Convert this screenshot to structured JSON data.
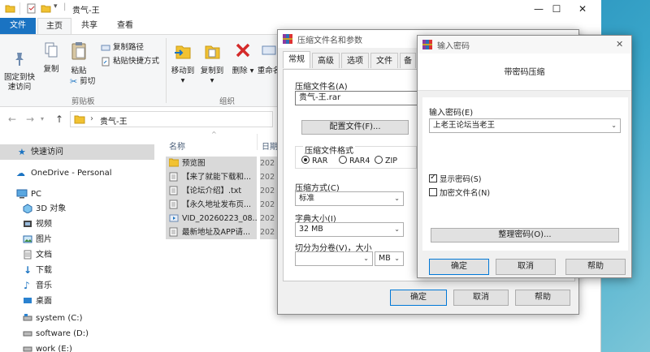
{
  "explorer": {
    "title": "贵气-王",
    "window_controls": {
      "minimize": "—",
      "maximize": "☐",
      "close": "✕"
    },
    "tabs": [
      "文件",
      "主页",
      "共享",
      "查看"
    ],
    "ribbon": {
      "pin_quick": "固定到快\n速访问",
      "copy": "复制",
      "paste": "粘贴",
      "copy_path": "复制路径",
      "paste_shortcut": "粘贴快捷方式",
      "cut": "剪切",
      "group_clipboard": "剪贴板",
      "move_to": "移动到",
      "copy_to": "复制到",
      "delete": "删除",
      "rename": "重命名",
      "group_organize": "组织"
    },
    "address": {
      "path": "贵气-王",
      "chevron": "›"
    },
    "nav": {
      "quick_access": "快速访问",
      "onedrive": "OneDrive - Personal",
      "pc": "PC",
      "objects3d": "3D 对象",
      "videos": "视频",
      "pictures": "图片",
      "documents": "文档",
      "downloads": "下载",
      "music": "音乐",
      "desktop": "桌面",
      "drive_c": "system (C:)",
      "drive_d": "software (D:)",
      "drive_e": "work (E:)"
    },
    "columns": {
      "name": "名称",
      "date": "日期"
    },
    "files": [
      {
        "name": "预览图",
        "date": "202"
      },
      {
        "name": "【来了就能下载和...",
        "date": "202"
      },
      {
        "name": "【论坛介绍】.txt",
        "date": "202"
      },
      {
        "name": "【永久地址发布页...",
        "date": "202"
      },
      {
        "name": "VID_20260223_08...",
        "date": "202"
      },
      {
        "name": "最新地址及APP请...",
        "date": "202"
      }
    ]
  },
  "archive": {
    "title": "压缩文件名和参数",
    "tabs": [
      "常规",
      "高级",
      "选项",
      "文件",
      "备"
    ],
    "name_label": "压缩文件名(A)",
    "name_value": "贵气-王.rar",
    "config_button": "配置文件(F)...",
    "format_label": "压缩文件格式",
    "formats": [
      "RAR",
      "RAR4",
      "ZIP"
    ],
    "method_label": "压缩方式(C)",
    "method_value": "标准",
    "dict_label": "字典大小(I)",
    "dict_value": "32 MB",
    "split_label": "切分为分卷(V)，大小",
    "split_unit": "MB",
    "ok": "确定",
    "cancel": "取消",
    "help": "帮助"
  },
  "password": {
    "title": "输入密码",
    "header": "带密码压缩",
    "password_label": "输入密码(E)",
    "password_value": "上老王论坛当老王",
    "show_password": "显示密码(S)",
    "encrypt_names": "加密文件名(N)",
    "organize_button": "整理密码(O)...",
    "ok": "确定",
    "cancel": "取消",
    "help": "帮助",
    "close": "✕"
  }
}
